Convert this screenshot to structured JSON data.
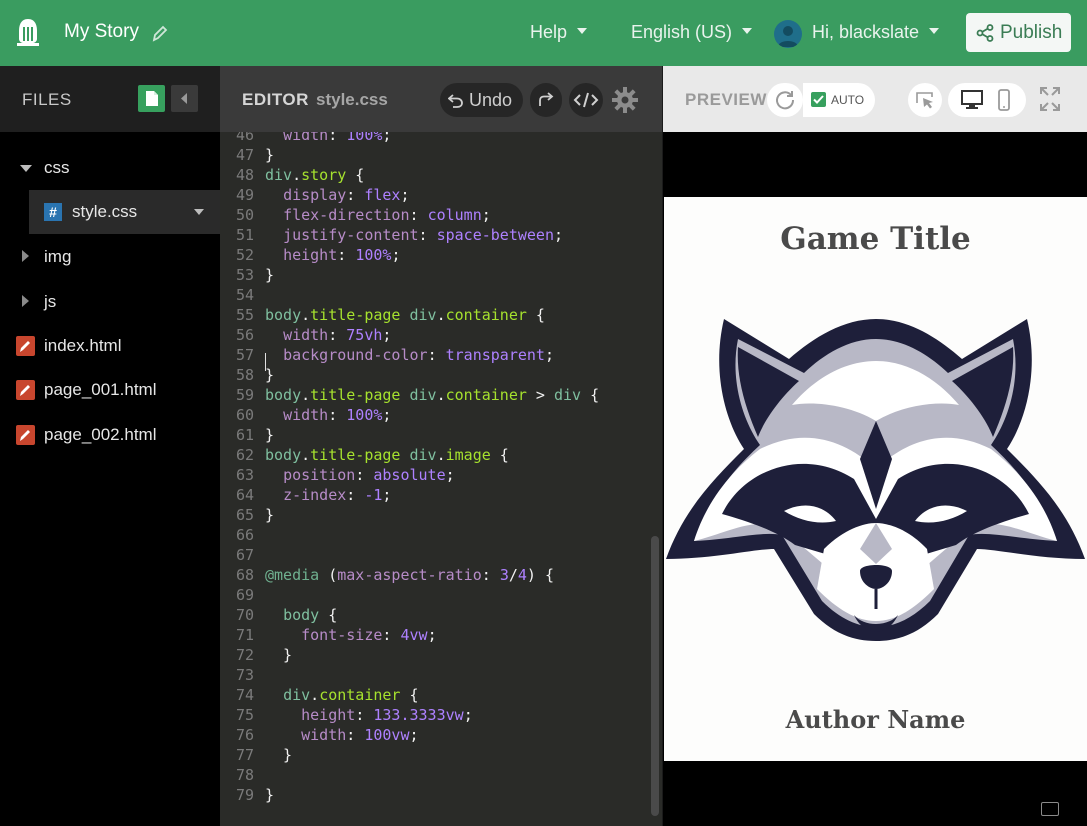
{
  "topbar": {
    "title": "My Story",
    "help": "Help",
    "language": "English (US)",
    "greeting": "Hi, blackslate",
    "publish": "Publish"
  },
  "files": {
    "header": "FILES",
    "items": [
      {
        "label": "css",
        "type": "folder-open"
      },
      {
        "label": "style.css",
        "type": "css-file"
      },
      {
        "label": "img",
        "type": "folder"
      },
      {
        "label": "js",
        "type": "folder"
      },
      {
        "label": "index.html",
        "type": "html-file"
      },
      {
        "label": "page_001.html",
        "type": "html-file"
      },
      {
        "label": "page_002.html",
        "type": "html-file"
      }
    ]
  },
  "editor": {
    "header": "EDITOR",
    "filename": "style.css",
    "undo": "Undo",
    "lines": [
      {
        "n": "46",
        "code": [
          [
            "  ",
            ""
          ],
          [
            "width",
            "k-prop"
          ],
          [
            ": ",
            ""
          ],
          [
            "100%",
            "k-val"
          ],
          [
            ";",
            ""
          ]
        ]
      },
      {
        "n": "47",
        "code": [
          [
            "}",
            ""
          ]
        ]
      },
      {
        "n": "48",
        "code": [
          [
            "div",
            "k-tag"
          ],
          [
            ".",
            ""
          ],
          [
            "story",
            "k-sel"
          ],
          [
            " {",
            ""
          ]
        ]
      },
      {
        "n": "49",
        "code": [
          [
            "  ",
            ""
          ],
          [
            "display",
            "k-prop"
          ],
          [
            ": ",
            ""
          ],
          [
            "flex",
            "k-val"
          ],
          [
            ";",
            ""
          ]
        ]
      },
      {
        "n": "50",
        "code": [
          [
            "  ",
            ""
          ],
          [
            "flex-direction",
            "k-prop"
          ],
          [
            ": ",
            ""
          ],
          [
            "column",
            "k-val"
          ],
          [
            ";",
            ""
          ]
        ]
      },
      {
        "n": "51",
        "code": [
          [
            "  ",
            ""
          ],
          [
            "justify-content",
            "k-prop"
          ],
          [
            ": ",
            ""
          ],
          [
            "space-between",
            "k-val"
          ],
          [
            ";",
            ""
          ]
        ]
      },
      {
        "n": "52",
        "code": [
          [
            "  ",
            ""
          ],
          [
            "height",
            "k-prop"
          ],
          [
            ": ",
            ""
          ],
          [
            "100%",
            "k-val"
          ],
          [
            ";",
            ""
          ]
        ]
      },
      {
        "n": "53",
        "code": [
          [
            "}",
            ""
          ]
        ]
      },
      {
        "n": "54",
        "code": []
      },
      {
        "n": "55",
        "code": [
          [
            "body",
            "k-tag"
          ],
          [
            ".",
            ""
          ],
          [
            "title-page",
            "k-sel"
          ],
          [
            " ",
            ""
          ],
          [
            "div",
            "k-tag"
          ],
          [
            ".",
            ""
          ],
          [
            "container",
            "k-sel"
          ],
          [
            " {",
            ""
          ]
        ]
      },
      {
        "n": "56",
        "code": [
          [
            "  ",
            ""
          ],
          [
            "width",
            "k-prop"
          ],
          [
            ": ",
            ""
          ],
          [
            "75vh",
            "k-val"
          ],
          [
            ";",
            ""
          ]
        ]
      },
      {
        "n": "57",
        "code": [
          [
            "  ",
            ""
          ],
          [
            "background-color",
            "k-prop"
          ],
          [
            ": ",
            ""
          ],
          [
            "transparent",
            "k-val"
          ],
          [
            ";",
            ""
          ]
        ]
      },
      {
        "n": "58",
        "code": [
          [
            "}",
            ""
          ]
        ]
      },
      {
        "n": "59",
        "code": [
          [
            "body",
            "k-tag"
          ],
          [
            ".",
            ""
          ],
          [
            "title-page",
            "k-sel"
          ],
          [
            " ",
            ""
          ],
          [
            "div",
            "k-tag"
          ],
          [
            ".",
            ""
          ],
          [
            "container",
            "k-sel"
          ],
          [
            " > ",
            ""
          ],
          [
            "div",
            "k-tag"
          ],
          [
            " {",
            ""
          ]
        ]
      },
      {
        "n": "60",
        "code": [
          [
            "  ",
            ""
          ],
          [
            "width",
            "k-prop"
          ],
          [
            ": ",
            ""
          ],
          [
            "100%",
            "k-val"
          ],
          [
            ";",
            ""
          ]
        ]
      },
      {
        "n": "61",
        "code": [
          [
            "}",
            ""
          ]
        ]
      },
      {
        "n": "62",
        "code": [
          [
            "body",
            "k-tag"
          ],
          [
            ".",
            ""
          ],
          [
            "title-page",
            "k-sel"
          ],
          [
            " ",
            ""
          ],
          [
            "div",
            "k-tag"
          ],
          [
            ".",
            ""
          ],
          [
            "image",
            "k-sel"
          ],
          [
            " {",
            ""
          ]
        ]
      },
      {
        "n": "63",
        "code": [
          [
            "  ",
            ""
          ],
          [
            "position",
            "k-prop"
          ],
          [
            ": ",
            ""
          ],
          [
            "absolute",
            "k-val"
          ],
          [
            ";",
            ""
          ]
        ]
      },
      {
        "n": "64",
        "code": [
          [
            "  ",
            ""
          ],
          [
            "z-index",
            "k-prop"
          ],
          [
            ": ",
            ""
          ],
          [
            "-1",
            "k-val"
          ],
          [
            ";",
            ""
          ]
        ]
      },
      {
        "n": "65",
        "code": [
          [
            "}",
            ""
          ]
        ]
      },
      {
        "n": "66",
        "code": []
      },
      {
        "n": "67",
        "code": []
      },
      {
        "n": "68",
        "code": [
          [
            "@media",
            "k-media"
          ],
          [
            " (",
            ""
          ],
          [
            "max-aspect-ratio",
            "k-prop"
          ],
          [
            ": ",
            ""
          ],
          [
            "3",
            "k-val"
          ],
          [
            "/",
            ""
          ],
          [
            "4",
            "k-val"
          ],
          [
            ") {",
            ""
          ]
        ]
      },
      {
        "n": "69",
        "code": []
      },
      {
        "n": "70",
        "code": [
          [
            "  ",
            ""
          ],
          [
            "body",
            "k-tag"
          ],
          [
            " {",
            ""
          ]
        ]
      },
      {
        "n": "71",
        "code": [
          [
            "    ",
            ""
          ],
          [
            "font-size",
            "k-prop"
          ],
          [
            ": ",
            ""
          ],
          [
            "4vw",
            "k-val"
          ],
          [
            ";",
            ""
          ]
        ]
      },
      {
        "n": "72",
        "code": [
          [
            "  }",
            ""
          ]
        ]
      },
      {
        "n": "73",
        "code": []
      },
      {
        "n": "74",
        "code": [
          [
            "  ",
            ""
          ],
          [
            "div",
            "k-tag"
          ],
          [
            ".",
            ""
          ],
          [
            "container",
            "k-sel"
          ],
          [
            " {",
            ""
          ]
        ]
      },
      {
        "n": "75",
        "code": [
          [
            "    ",
            ""
          ],
          [
            "height",
            "k-prop"
          ],
          [
            ": ",
            ""
          ],
          [
            "133.3333vw",
            "k-val"
          ],
          [
            ";",
            ""
          ]
        ]
      },
      {
        "n": "76",
        "code": [
          [
            "    ",
            ""
          ],
          [
            "width",
            "k-prop"
          ],
          [
            ": ",
            ""
          ],
          [
            "100vw",
            "k-val"
          ],
          [
            ";",
            ""
          ]
        ]
      },
      {
        "n": "77",
        "code": [
          [
            "  }",
            ""
          ]
        ]
      },
      {
        "n": "78",
        "code": []
      },
      {
        "n": "79",
        "code": [
          [
            "}",
            ""
          ]
        ]
      }
    ]
  },
  "preview": {
    "header": "PREVIEW",
    "auto": "AUTO",
    "auto_checked": true,
    "game_title": "Game Title",
    "author_name": "Author Name"
  },
  "colors": {
    "topbar": "#3a9c60",
    "accent": "#37a05e",
    "editor_bg": "#2a2b28"
  }
}
